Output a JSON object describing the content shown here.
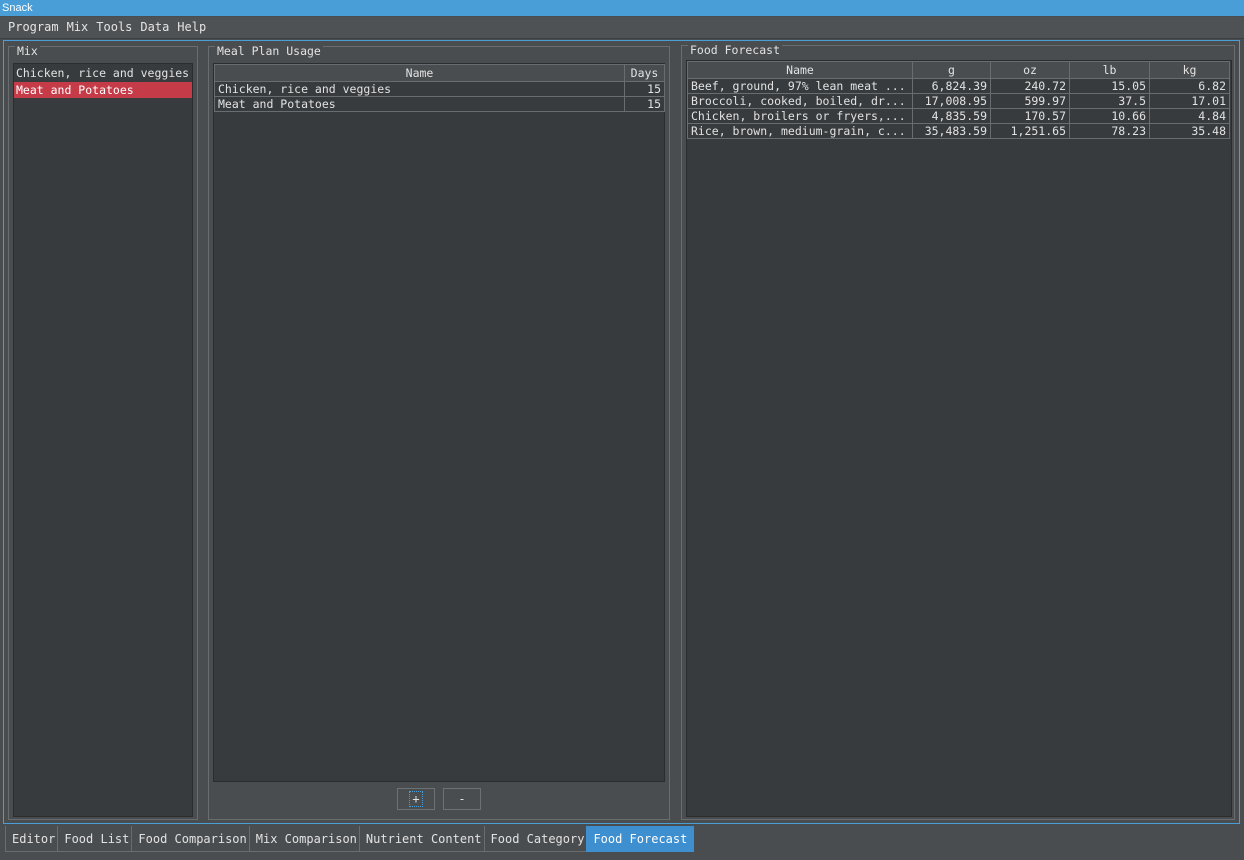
{
  "window": {
    "title": "Snack"
  },
  "menu": [
    "Program",
    "Mix",
    "Tools",
    "Data",
    "Help"
  ],
  "mix_panel": {
    "title": "Mix",
    "items": [
      "Chicken, rice and veggies",
      "Meat and Potatoes"
    ],
    "selected_index": 1
  },
  "meal_plan": {
    "title": "Meal Plan Usage",
    "columns": [
      "Name",
      "Days"
    ],
    "rows": [
      [
        "Chicken, rice and veggies",
        "15"
      ],
      [
        "Meat and Potatoes",
        "15"
      ]
    ],
    "add_label": "+",
    "remove_label": "-"
  },
  "forecast": {
    "title": "Food Forecast",
    "columns": [
      "Name",
      "g",
      "oz",
      "lb",
      "kg"
    ],
    "rows": [
      [
        "Beef, ground, 97% lean meat ...",
        "6,824.39",
        "240.72",
        "15.05",
        "6.82"
      ],
      [
        "Broccoli, cooked, boiled, dr...",
        "17,008.95",
        "599.97",
        "37.5",
        "17.01"
      ],
      [
        "Chicken, broilers or fryers,...",
        "4,835.59",
        "170.57",
        "10.66",
        "4.84"
      ],
      [
        "Rice, brown, medium-grain, c...",
        "35,483.59",
        "1,251.65",
        "78.23",
        "35.48"
      ]
    ]
  },
  "tabs": [
    "Editor",
    "Food List",
    "Food Comparison",
    "Mix Comparison",
    "Nutrient Content",
    "Food Category",
    "Food Forecast"
  ],
  "active_tab": 6,
  "colors": {
    "accent": "#4a9ed8",
    "selection": "#c63b48",
    "background": "#4a4d50",
    "list_background": "#383b3e"
  }
}
